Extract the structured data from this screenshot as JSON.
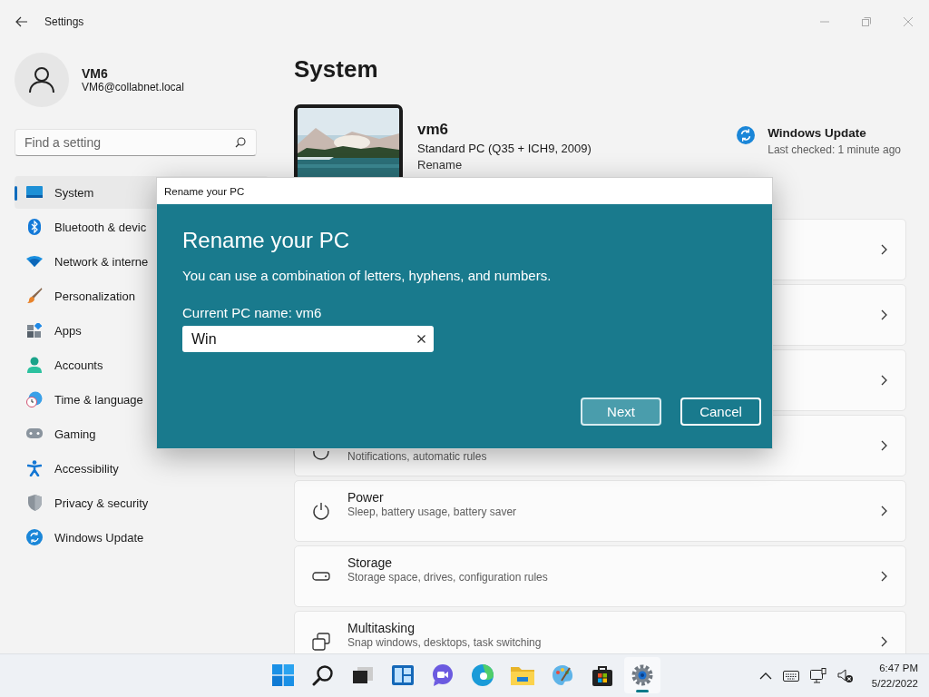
{
  "window": {
    "title": "Settings"
  },
  "user": {
    "name": "VM6",
    "email": "VM6@collabnet.local"
  },
  "search": {
    "placeholder": "Find a setting"
  },
  "nav": [
    {
      "label": "System",
      "kind": "system",
      "selected": true
    },
    {
      "label": "Bluetooth & devic",
      "kind": "bluetooth",
      "selected": false
    },
    {
      "label": "Network & interne",
      "kind": "network",
      "selected": false
    },
    {
      "label": "Personalization",
      "kind": "brush",
      "selected": false
    },
    {
      "label": "Apps",
      "kind": "apps",
      "selected": false
    },
    {
      "label": "Accounts",
      "kind": "accounts",
      "selected": false
    },
    {
      "label": "Time & language",
      "kind": "time",
      "selected": false
    },
    {
      "label": "Gaming",
      "kind": "gaming",
      "selected": false
    },
    {
      "label": "Accessibility",
      "kind": "accessibility",
      "selected": false
    },
    {
      "label": "Privacy & security",
      "kind": "privacy",
      "selected": false
    },
    {
      "label": "Windows Update",
      "kind": "update",
      "selected": false
    }
  ],
  "page": {
    "title": "System"
  },
  "device": {
    "name": "vm6",
    "model": "Standard PC (Q35 + ICH9, 2009)",
    "link": "Rename"
  },
  "update": {
    "title": "Windows Update",
    "status": "Last checked: 1 minute ago"
  },
  "cards": [
    {
      "kind": "none"
    },
    {
      "kind": "none"
    },
    {
      "kind": "none"
    },
    {
      "kind": "focus",
      "subtitle": "Notifications, automatic rules"
    },
    {
      "kind": "power",
      "title": "Power",
      "subtitle": "Sleep, battery usage, battery saver"
    },
    {
      "kind": "storage",
      "title": "Storage",
      "subtitle": "Storage space, drives, configuration rules"
    },
    {
      "kind": "multitasking",
      "title": "Multitasking",
      "subtitle": "Snap windows, desktops, task switching"
    }
  ],
  "dialog": {
    "window_title": "Rename your PC",
    "heading": "Rename your PC",
    "description": "You can use a combination of letters, hyphens, and numbers.",
    "label": "Current PC name: vm6",
    "value": "Win",
    "buttons": [
      {
        "label": "Next",
        "kind": "primary"
      },
      {
        "label": "Cancel",
        "kind": "secondary"
      }
    ]
  },
  "taskbar": {
    "apps": [
      {
        "kind": "start",
        "selected": false
      },
      {
        "kind": "search",
        "selected": false
      },
      {
        "kind": "taskview",
        "selected": false
      },
      {
        "kind": "widgets",
        "selected": false
      },
      {
        "kind": "chat",
        "selected": false
      },
      {
        "kind": "edge",
        "selected": false
      },
      {
        "kind": "explorer",
        "selected": false
      },
      {
        "kind": "paint",
        "selected": false
      },
      {
        "kind": "store",
        "selected": false
      },
      {
        "kind": "settings",
        "selected": true
      }
    ],
    "time": "6:47 PM",
    "date": "5/22/2022"
  }
}
